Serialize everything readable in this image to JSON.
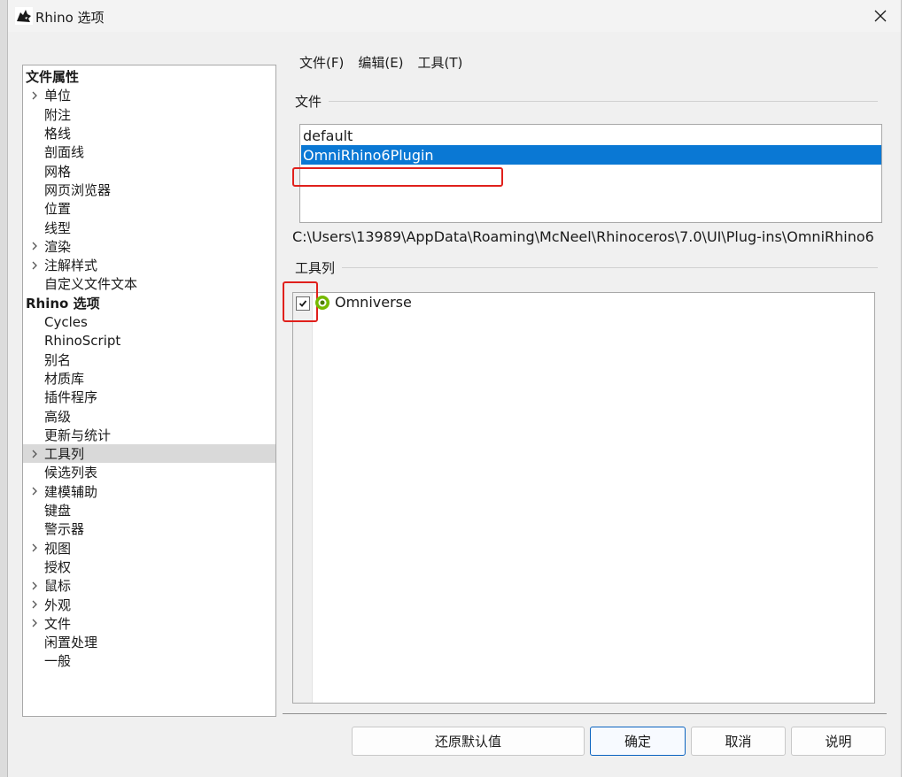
{
  "window": {
    "title": "Rhino 选项"
  },
  "tree": [
    {
      "label": "文件属性",
      "type": "group",
      "expand": false
    },
    {
      "label": "单位",
      "type": "item",
      "expand": true
    },
    {
      "label": "附注",
      "type": "item",
      "expand": false
    },
    {
      "label": "格线",
      "type": "item",
      "expand": false
    },
    {
      "label": "剖面线",
      "type": "item",
      "expand": false
    },
    {
      "label": "网格",
      "type": "item",
      "expand": false
    },
    {
      "label": "网页浏览器",
      "type": "item",
      "expand": false
    },
    {
      "label": "位置",
      "type": "item",
      "expand": false
    },
    {
      "label": "线型",
      "type": "item",
      "expand": false
    },
    {
      "label": "渲染",
      "type": "item",
      "expand": true
    },
    {
      "label": "注解样式",
      "type": "item",
      "expand": true
    },
    {
      "label": "自定义文件文本",
      "type": "item",
      "expand": false
    },
    {
      "label": "Rhino 选项",
      "type": "group",
      "expand": false
    },
    {
      "label": "Cycles",
      "type": "item",
      "expand": false
    },
    {
      "label": "RhinoScript",
      "type": "item",
      "expand": false
    },
    {
      "label": "别名",
      "type": "item",
      "expand": false
    },
    {
      "label": "材质库",
      "type": "item",
      "expand": false
    },
    {
      "label": "插件程序",
      "type": "item",
      "expand": false
    },
    {
      "label": "高级",
      "type": "item",
      "expand": false
    },
    {
      "label": "更新与统计",
      "type": "item",
      "expand": false
    },
    {
      "label": "工具列",
      "type": "item",
      "expand": true,
      "selected": true
    },
    {
      "label": "候选列表",
      "type": "item",
      "expand": false
    },
    {
      "label": "建模辅助",
      "type": "item",
      "expand": true
    },
    {
      "label": "键盘",
      "type": "item",
      "expand": false
    },
    {
      "label": "警示器",
      "type": "item",
      "expand": false
    },
    {
      "label": "视图",
      "type": "item",
      "expand": true
    },
    {
      "label": "授权",
      "type": "item",
      "expand": false
    },
    {
      "label": "鼠标",
      "type": "item",
      "expand": true
    },
    {
      "label": "外观",
      "type": "item",
      "expand": true
    },
    {
      "label": "文件",
      "type": "item",
      "expand": true
    },
    {
      "label": "闲置处理",
      "type": "item",
      "expand": false
    },
    {
      "label": "一般",
      "type": "item",
      "expand": false
    }
  ],
  "menubar": {
    "file": "文件(F)",
    "edit": "编辑(E)",
    "tools": "工具(T)"
  },
  "files_section": {
    "header": "文件",
    "items": [
      "default",
      "OmniRhino6Plugin"
    ],
    "selected_index": 1,
    "path": "C:\\Users\\13989\\AppData\\Roaming\\McNeel\\Rhinoceros\\7.0\\UI\\Plug-ins\\OmniRhino6"
  },
  "toolbars_section": {
    "header": "工具列",
    "items": [
      {
        "label": "Omniverse",
        "checked": true
      }
    ]
  },
  "buttons": {
    "restore": "还原默认值",
    "ok": "确定",
    "cancel": "取消",
    "help": "说明"
  },
  "colors": {
    "selection": "#0a78d4",
    "annotation": "#e0201c",
    "omni_icon": "#76b900"
  }
}
